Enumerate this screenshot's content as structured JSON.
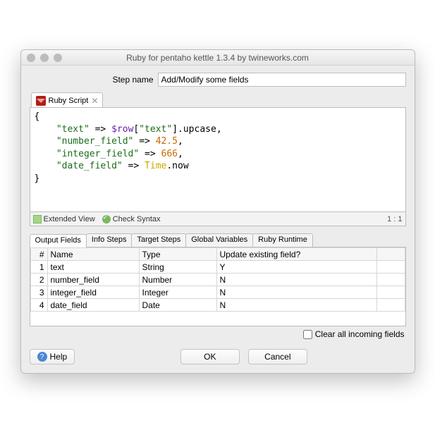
{
  "window": {
    "title": "Ruby for pentaho kettle 1.3.4 by twineworks.com"
  },
  "stepname": {
    "label": "Step name",
    "value": "Add/Modify some fields"
  },
  "scriptTab": {
    "label": "Ruby Script"
  },
  "code": {
    "l1": "{",
    "l2a": "    ",
    "l2b": "\"text\"",
    "l2c": " => ",
    "l2d": "$row",
    "l2e": "[",
    "l2f": "\"text\"",
    "l2g": "].upcase,",
    "l3a": "    ",
    "l3b": "\"number_field\"",
    "l3c": " => ",
    "l3d": "42.5",
    "l3e": ",",
    "l4a": "    ",
    "l4b": "\"integer_field\"",
    "l4c": " => ",
    "l4d": "666",
    "l4e": ",",
    "l5a": "    ",
    "l5b": "\"date_field\"",
    "l5c": " => ",
    "l5d": "Time",
    "l5e": ".now",
    "l6": "}"
  },
  "toolbar": {
    "extended": "Extended View",
    "check": "Check Syntax",
    "cursor": "1 : 1"
  },
  "tabs": [
    "Output Fields",
    "Info Steps",
    "Target Steps",
    "Global Variables",
    "Ruby Runtime"
  ],
  "grid": {
    "headers": [
      "#",
      "Name",
      "Type",
      "Update existing field?"
    ],
    "rows": [
      {
        "n": "1",
        "name": "text",
        "type": "String",
        "update": "Y"
      },
      {
        "n": "2",
        "name": "number_field",
        "type": "Number",
        "update": "N"
      },
      {
        "n": "3",
        "name": "integer_field",
        "type": "Integer",
        "update": "N"
      },
      {
        "n": "4",
        "name": "date_field",
        "type": "Date",
        "update": "N"
      }
    ]
  },
  "clear": {
    "label": "Clear all incoming fields"
  },
  "buttons": {
    "help": "Help",
    "ok": "OK",
    "cancel": "Cancel"
  }
}
